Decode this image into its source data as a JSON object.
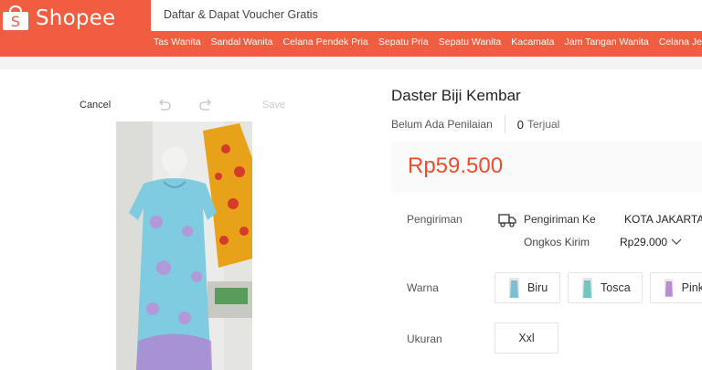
{
  "header": {
    "logo_text": "Shopee",
    "search_placeholder": "Daftar & Dapat Voucher Gratis",
    "categories": [
      "Tas Wanita",
      "Sandal Wanita",
      "Celana Pendek Pria",
      "Sepatu Pria",
      "Sepatu Wanita",
      "Kacamata",
      "Jam Tangan Wanita",
      "Celana Jeans"
    ]
  },
  "editor": {
    "cancel": "Cancel",
    "save": "Save"
  },
  "product": {
    "title": "Daster Biji Kembar",
    "rating_text": "Belum Ada Penilaian",
    "sold_count": "0",
    "sold_label": "Terjual",
    "price": "Rp59.500"
  },
  "shipping": {
    "label": "Pengiriman",
    "to_label": "Pengiriman Ke",
    "city": "KOTA JAKARTA",
    "cost_label": "Ongkos Kirim",
    "cost": "Rp29.000"
  },
  "variants": {
    "color_label": "Warna",
    "colors": [
      "Biru",
      "Tosca",
      "Pink"
    ],
    "size_label": "Ukuran",
    "sizes": [
      "Xxl"
    ]
  },
  "colors": {
    "brand": "#ee4d2d",
    "header_bg": "#f05d40"
  }
}
